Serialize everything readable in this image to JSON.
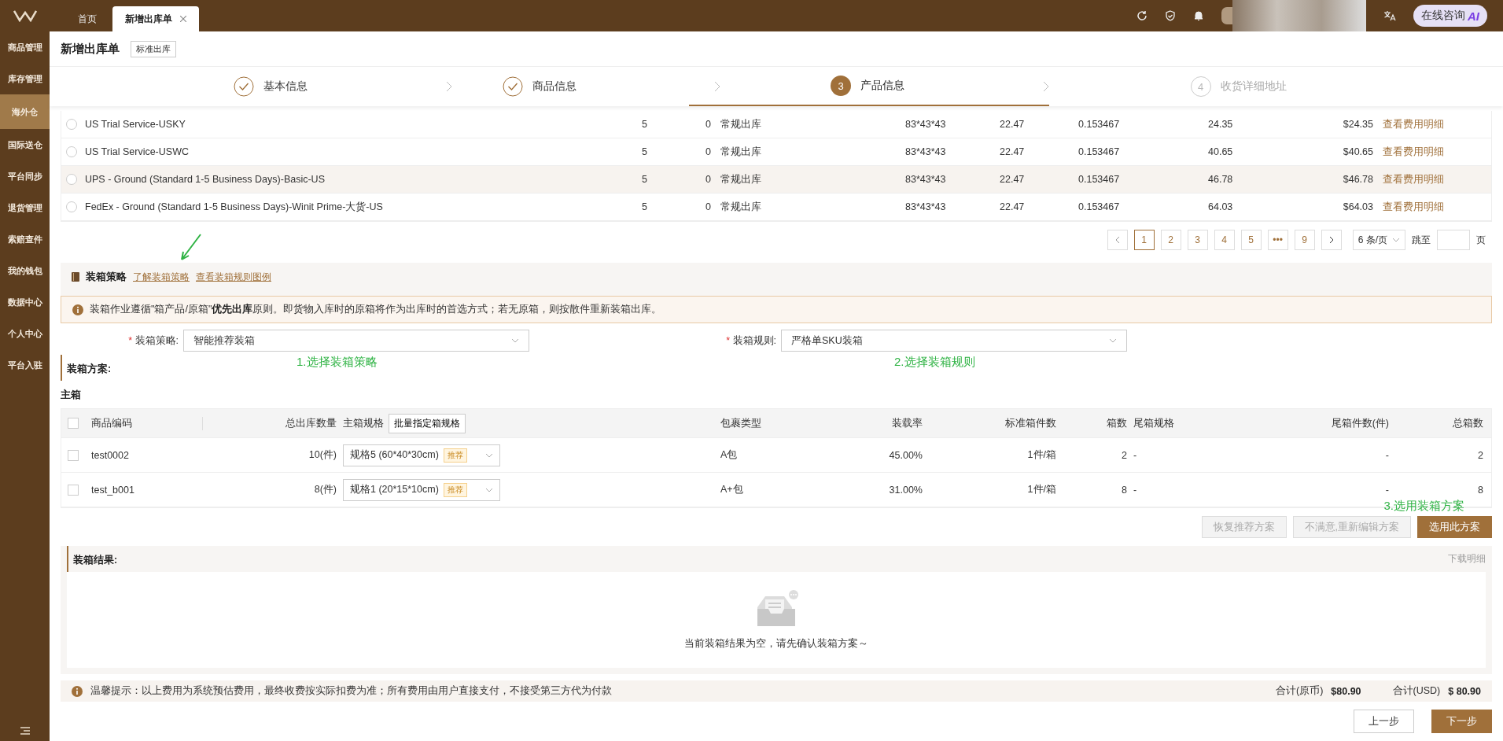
{
  "tabs": [
    {
      "label": "首页",
      "selected": false,
      "closable": false
    },
    {
      "label": "新增出库单",
      "selected": true,
      "closable": true
    }
  ],
  "topbar": {
    "consult_label": "在线咨询",
    "ai_badge": "AI"
  },
  "sidebar": {
    "items": [
      {
        "label": "商品管理",
        "selected": false
      },
      {
        "label": "库存管理",
        "selected": false
      },
      {
        "label": "海外仓",
        "selected": true
      },
      {
        "label": "国际送仓",
        "selected": false
      },
      {
        "label": "平台同步",
        "selected": false
      },
      {
        "label": "退货管理",
        "selected": false
      },
      {
        "label": "索赔查件",
        "selected": false
      },
      {
        "label": "我的钱包",
        "selected": false
      },
      {
        "label": "数据中心",
        "selected": false
      },
      {
        "label": "个人中心",
        "selected": false
      },
      {
        "label": "平台入驻",
        "selected": false
      }
    ]
  },
  "header": {
    "title": "新增出库单",
    "tag": "标准出库"
  },
  "steps": [
    {
      "label": "基本信息",
      "kind": "done"
    },
    {
      "label": "商品信息",
      "kind": "done"
    },
    {
      "number": "3",
      "label": "产品信息",
      "kind": "current"
    },
    {
      "number": "4",
      "label": "收货详细地址",
      "kind": "todo"
    }
  ],
  "services": {
    "rows": [
      {
        "name": "US Trial Service-USKY",
        "column_2": "5",
        "column_3": "0",
        "column_4": "常规出库",
        "column_5": "83*43*43",
        "column_6": "22.47",
        "column_7": "0.153467",
        "column_8": "24.35",
        "price": "$24.35",
        "link": "查看费用明细",
        "selected": false,
        "hovered": false
      },
      {
        "name": "US Trial Service-USWC",
        "column_2": "5",
        "column_3": "0",
        "column_4": "常规出库",
        "column_5": "83*43*43",
        "column_6": "22.47",
        "column_7": "0.153467",
        "column_8": "40.65",
        "price": "$40.65",
        "link": "查看费用明细",
        "selected": false,
        "hovered": false
      },
      {
        "name": "UPS - Ground (Standard 1-5 Business Days)-Basic-US",
        "column_2": "5",
        "column_3": "0",
        "column_4": "常规出库",
        "column_5": "83*43*43",
        "column_6": "22.47",
        "column_7": "0.153467",
        "column_8": "46.78",
        "price": "$46.78",
        "link": "查看费用明细",
        "selected": false,
        "hovered": true
      },
      {
        "name": "FedEx - Ground (Standard 1-5 Business Days)-Winit Prime-大货-US",
        "column_2": "5",
        "column_3": "0",
        "column_4": "常规出库",
        "column_5": "83*43*43",
        "column_6": "22.47",
        "column_7": "0.153467",
        "column_8": "64.03",
        "price": "$64.03",
        "link": "查看费用明细",
        "selected": false,
        "hovered": false
      }
    ]
  },
  "pagination": {
    "pages": [
      {
        "label": "1",
        "selected": true
      },
      {
        "label": "2",
        "selected": false
      },
      {
        "label": "3",
        "selected": false
      },
      {
        "label": "4",
        "selected": false
      },
      {
        "label": "5",
        "selected": false
      },
      {
        "label": "•••",
        "selected": false
      },
      {
        "label": "9",
        "selected": false
      }
    ],
    "page_size": "6 条/页",
    "jump_label": "跳至",
    "page_unit": "页"
  },
  "strategy": {
    "title": "装箱策略",
    "links": [
      "了解装箱策略",
      "查看装箱规则图例"
    ],
    "notice": "装箱作业遵循\"箱产品/原箱\"**优先出库**原则。即货物入库时的原箱将作为出库时的首选方式；若无原箱，则按散件重新装箱出库。",
    "fields": [
      {
        "required_mark": "*",
        "label": "装箱策略:",
        "value": "智能推荐装箱",
        "annotation": "1.选择装箱策略"
      },
      {
        "required_mark": "*",
        "label": "装箱规则:",
        "value": "严格单SKU装箱",
        "annotation": "2.选择装箱规则"
      }
    ]
  },
  "plan": {
    "title": "装箱方案:",
    "subtitle": "主箱",
    "columns": [
      "商品编码",
      "总出库数量",
      "主箱规格",
      "包裹类型",
      "装载率",
      "标准箱件数",
      "箱数",
      "尾箱规格",
      "尾箱件数(件)",
      "总箱数"
    ],
    "batch_button": "批量指定箱规格",
    "all_checked": false,
    "rows": [
      {
        "code": "test0002",
        "qty": "10(件)",
        "spec": "规格5 (60*40*30cm)",
        "badge": "推荐",
        "package": "A包",
        "rate": "45.00%",
        "per_box": "1件/箱",
        "boxes": "2",
        "tail_spec": "-",
        "tail_qty": "-",
        "total": "2",
        "checked": false
      },
      {
        "code": "test_b001",
        "qty": "8(件)",
        "spec": "规格1 (20*15*10cm)",
        "badge": "推荐",
        "package": "A+包",
        "rate": "31.00%",
        "per_box": "1件/箱",
        "boxes": "8",
        "tail_spec": "-",
        "tail_qty": "-",
        "total": "8",
        "checked": false
      }
    ],
    "annotation": "3.选用装箱方案",
    "buttons": [
      {
        "label": "恢复推荐方案",
        "disabled": true,
        "primary": false
      },
      {
        "label": "不满意,重新编辑方案",
        "disabled": true,
        "primary": false
      },
      {
        "label": "选用此方案",
        "disabled": false,
        "primary": true
      }
    ]
  },
  "result": {
    "title": "装箱结果:",
    "download": "下载明细",
    "empty_text": "当前装箱结果为空，请先确认装箱方案～"
  },
  "footer": {
    "tip": "温馨提示：以上费用为系统预估费用，最终收费按实际扣费为准；所有费用由用户直接支付，不接受第三方代为付款",
    "total_local_label": "合计(原币)",
    "total_local": "$80.90",
    "total_usd_label": "合计(USD)",
    "total_usd": "$ 80.90"
  },
  "nav_buttons": [
    {
      "label": "上一步",
      "primary": false
    },
    {
      "label": "下一步",
      "primary": true
    }
  ]
}
